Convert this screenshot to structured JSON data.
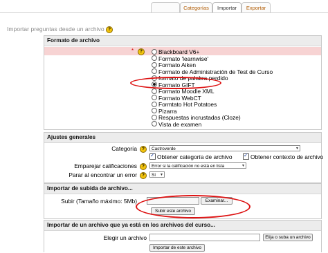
{
  "tabs": [
    {
      "label": ""
    },
    {
      "label": "Categorías"
    },
    {
      "label": "Importar"
    },
    {
      "label": "Exportar"
    }
  ],
  "page_title": "Importar preguntas desde un archivo",
  "help_glyph": "?",
  "format_section": {
    "legend": "Formato de archivo",
    "required_mark": "*",
    "options": [
      {
        "label": "Blackboard V6+",
        "selected": false
      },
      {
        "label": "Formato 'learnwise'",
        "selected": false
      },
      {
        "label": "Formato Aiken",
        "selected": false
      },
      {
        "label": "Formato de Administración de Test de Curso",
        "selected": false
      },
      {
        "label": "formato de palabra perdido",
        "selected": false
      },
      {
        "label": "Formato GIFT",
        "selected": true
      },
      {
        "label": "Formato Moodle XML",
        "selected": false
      },
      {
        "label": "Formato WebCT",
        "selected": false
      },
      {
        "label": "Formtato Hot Potatoes",
        "selected": false
      },
      {
        "label": "Pizarra",
        "selected": false
      },
      {
        "label": "Respuestas incrustadas (Cloze)",
        "selected": false
      },
      {
        "label": "Vista de examen",
        "selected": false
      }
    ]
  },
  "general_section": {
    "legend": "Ajustes generales",
    "category_label": "Categoría",
    "category_value": "Castroverde",
    "checkbox_category": "Obtener categoría de archivo",
    "checkbox_context": "Obtener contexto de archivo",
    "match_label": "Emparejar calificaciones",
    "match_value": "Error si la calificación no está en lista",
    "stop_label": "Parar al encontrar un error",
    "stop_value": "Sí"
  },
  "upload_section": {
    "legend": "Importar de subida de archivo...",
    "upload_label": "Subir (Tamaño máximo: 5Mb)",
    "browse_button": "Examinar...",
    "submit_button": "Subir este archivo"
  },
  "course_section": {
    "legend": "Importar de un archivo que ya está en los archivos del curso...",
    "choose_label": "Elegir un archivo",
    "choose_button": "Elija o suba un archivo",
    "import_button": "Importar de este archivo"
  },
  "colors": {
    "annotation": "#d11111",
    "tab_text": "#b05a00",
    "required_bg": "#f7d3d3",
    "header_bg": "#ececec"
  }
}
